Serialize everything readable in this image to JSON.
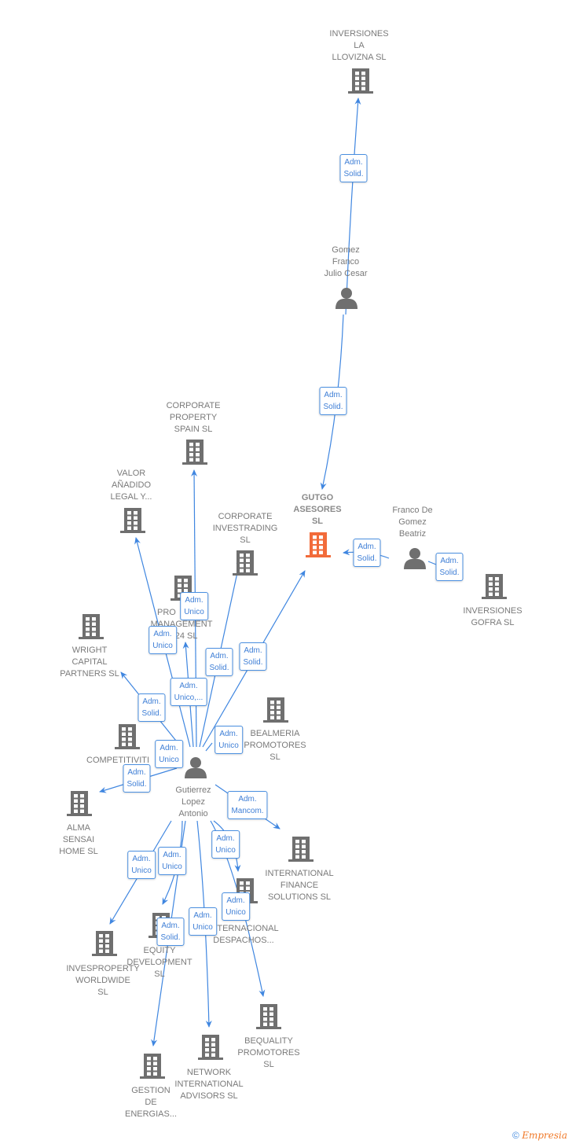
{
  "colors": {
    "edge": "#3f86e0",
    "node": "#6f6f6f",
    "focus": "#f26b3a"
  },
  "nodes": [
    {
      "id": "llovizna",
      "type": "company",
      "label": [
        "INVERSIONES",
        "LA",
        "LLOVIZNA SL"
      ]
    },
    {
      "id": "gomez",
      "type": "person",
      "label": [
        "Gomez",
        "Franco",
        "Julio Cesar"
      ]
    },
    {
      "id": "gutgo",
      "type": "company",
      "focus": true,
      "label": [
        "GUTGO",
        "ASESORES",
        "SL"
      ]
    },
    {
      "id": "beatriz",
      "type": "person",
      "label": [
        "Franco De",
        "Gomez",
        "Beatriz"
      ]
    },
    {
      "id": "gofra",
      "type": "company",
      "label": [
        "INVERSIONES",
        "GOFRA SL"
      ]
    },
    {
      "id": "cps",
      "type": "company",
      "label": [
        "CORPORATE",
        "PROPERTY",
        "SPAIN  SL"
      ]
    },
    {
      "id": "valor",
      "type": "company",
      "label": [
        "VALOR",
        "AÑADIDO",
        "LEGAL Y..."
      ]
    },
    {
      "id": "cinv",
      "type": "company",
      "label": [
        "CORPORATE",
        "INVESTRADING",
        "SL"
      ]
    },
    {
      "id": "promgmt",
      "type": "company",
      "label": [
        "PRO",
        "MANAGEMENT",
        "2024  SL"
      ]
    },
    {
      "id": "wright",
      "type": "company",
      "label": [
        "WRIGHT",
        "CAPITAL",
        "PARTNERS  SL"
      ]
    },
    {
      "id": "bealmeria",
      "type": "company",
      "label": [
        "BEALMERIA",
        "PROMOTORES",
        "SL"
      ]
    },
    {
      "id": "compet",
      "type": "company",
      "label": [
        "COMPETITIVITI"
      ]
    },
    {
      "id": "gutierrez",
      "type": "person",
      "label": [
        "Gutierrez",
        "Lopez",
        "Antonio"
      ]
    },
    {
      "id": "alma",
      "type": "company",
      "label": [
        "ALMA",
        "SENSAI",
        "HOME  SL"
      ]
    },
    {
      "id": "ifs",
      "type": "company",
      "label": [
        "INTERNATIONAL",
        "FINANCE",
        "SOLUTIONS  SL"
      ]
    },
    {
      "id": "despachos",
      "type": "company",
      "label": [
        "INTERNACIONAL",
        "DESPACHOS..."
      ]
    },
    {
      "id": "invesprop",
      "type": "company",
      "label": [
        "INVESPROPERTY",
        "WORLDWIDE",
        "SL"
      ]
    },
    {
      "id": "equity",
      "type": "company",
      "label": [
        "EQUITY",
        "DEVELOPMENT",
        "SL"
      ]
    },
    {
      "id": "bequality",
      "type": "company",
      "label": [
        "BEQUALITY",
        "PROMOTORES",
        "SL"
      ]
    },
    {
      "id": "network",
      "type": "company",
      "label": [
        "NETWORK",
        "INTERNATIONAL",
        "ADVISORS  SL"
      ]
    },
    {
      "id": "gestion",
      "type": "company",
      "label": [
        "GESTION",
        "DE",
        "ENERGIAS..."
      ]
    }
  ],
  "edges": [
    {
      "from": "gomez",
      "to": "llovizna",
      "role": "Adm.\nSolid."
    },
    {
      "from": "gomez",
      "to": "gutgo",
      "role": "Adm.\nSolid."
    },
    {
      "from": "beatriz",
      "to": "gutgo",
      "role": "Adm.\nSolid."
    },
    {
      "from": "beatriz",
      "to": "gofra",
      "role": "Adm.\nSolid."
    },
    {
      "from": "gutierrez",
      "to": "cps",
      "role": "Adm.\nUnico"
    },
    {
      "from": "gutierrez",
      "to": "valor",
      "role": "Adm.\nUnico"
    },
    {
      "from": "gutierrez",
      "to": "promgmt",
      "role": "Adm.\nUnico,..."
    },
    {
      "from": "gutierrez",
      "to": "cinv",
      "role": "Adm.\nSolid."
    },
    {
      "from": "gutierrez",
      "to": "gutgo",
      "role": "Adm.\nSolid."
    },
    {
      "from": "gutierrez",
      "to": "wright",
      "role": "Adm.\nSolid."
    },
    {
      "from": "gutierrez",
      "to": "bealmeria",
      "role": "Adm.\nUnico"
    },
    {
      "from": "gutierrez",
      "to": "compet",
      "role": "Adm.\nUnico"
    },
    {
      "from": "gutierrez",
      "to": "alma",
      "role": "Adm.\nSolid."
    },
    {
      "from": "gutierrez",
      "to": "ifs",
      "role": "Adm.\nMancom."
    },
    {
      "from": "gutierrez",
      "to": "despachos",
      "role": "Adm.\nUnico"
    },
    {
      "from": "gutierrez",
      "to": "invesprop",
      "role": "Adm.\nUnico"
    },
    {
      "from": "gutierrez",
      "to": "equity",
      "role": "Adm.\nUnico"
    },
    {
      "from": "gutierrez",
      "to": "gestion",
      "role": "Adm.\nSolid."
    },
    {
      "from": "gutierrez",
      "to": "network",
      "role": "Adm.\nUnico"
    },
    {
      "from": "gutierrez",
      "to": "bequality",
      "role": "Adm.\nUnico"
    }
  ],
  "footer": {
    "copyright": "©",
    "brand": "Empresia"
  }
}
